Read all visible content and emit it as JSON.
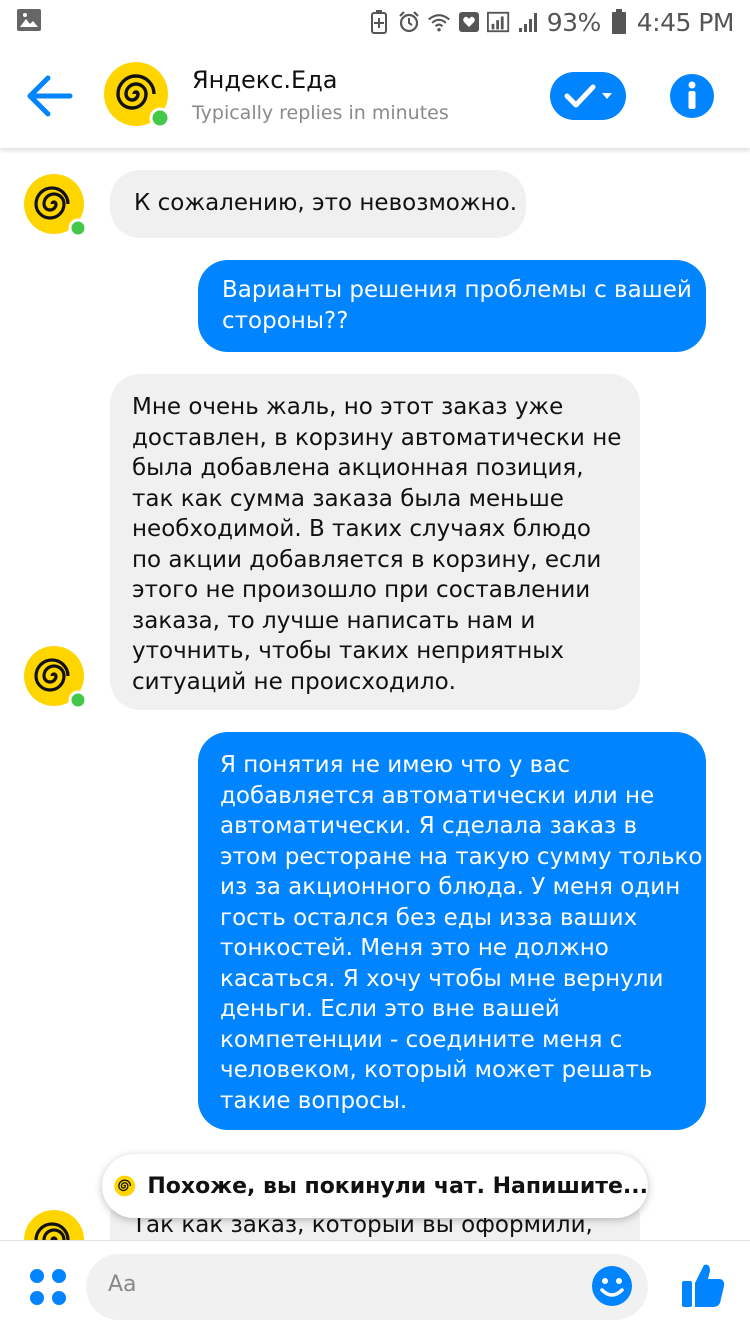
{
  "status_bar": {
    "battery_percent": "93%",
    "time": "4:45 PM"
  },
  "header": {
    "name": "Яндекс.Еда",
    "subtitle": "Typically replies in minutes"
  },
  "messages": [
    {
      "sender": "bot",
      "lines": [
        "К сожалению, это невозможно."
      ]
    },
    {
      "sender": "user",
      "lines": [
        "Варианты решения проблемы с вашей",
        "стороны??"
      ]
    },
    {
      "sender": "bot",
      "lines": [
        "Мне очень жаль, но этот заказ уже",
        "доставлен, в корзину автоматически не",
        "была добавлена акционная позиция,",
        "так как сумма заказа была меньше",
        "необходимой. В таких случаях блюдо",
        "по акции добавляется в корзину, если",
        "этого не произошло при составлении",
        "заказа, то лучше написать нам и",
        "уточнить, чтобы таких неприятных",
        "ситуаций не происходило."
      ]
    },
    {
      "sender": "user",
      "lines": [
        "Я понятия не имею что у вас",
        "добавляется автоматически или не",
        "автоматически. Я сделала заказ в",
        "этом ресторане на такую сумму только",
        "из за акционного блюда. У меня один",
        "гость остался без еды изза ваших",
        "тонкостей. Меня это не должно",
        "касаться. Я хочу чтобы мне вернули",
        "деньги. Если это вне вашей",
        "компетенции - соедините меня с",
        "человеком, который может решать",
        "такие вопросы."
      ]
    },
    {
      "sender": "bot",
      "lines": [
        "Так как заказ, который вы оформили,"
      ]
    }
  ],
  "toast": {
    "text": "Похоже, вы покинули чат. Напишите..."
  },
  "composer": {
    "placeholder": "Aa"
  },
  "colors": {
    "messenger_blue": "#0084ff",
    "brand_yellow": "#ffd500",
    "online_green": "#44c84a",
    "incoming_bubble": "#f1f0f0"
  }
}
